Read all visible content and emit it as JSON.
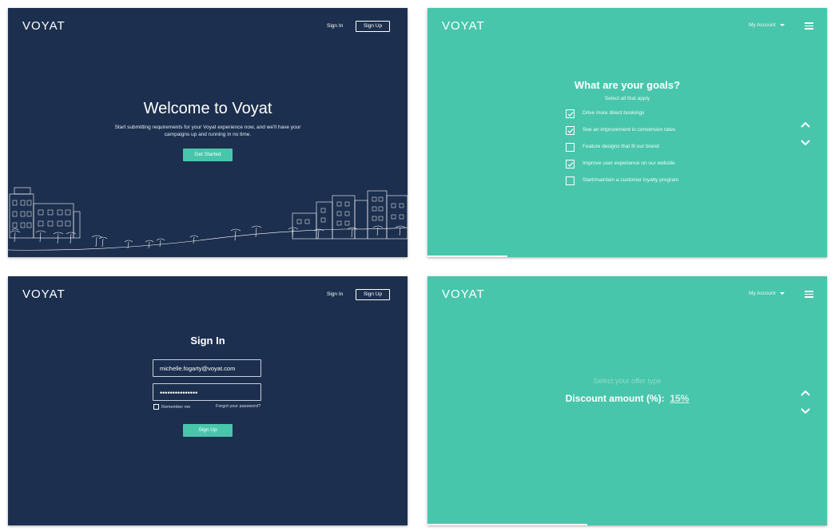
{
  "brand": {
    "logo": "VOYAT",
    "navy": "#1c2f4e",
    "teal": "#48c6ac"
  },
  "welcome_screen": {
    "nav": {
      "sign_in": "Sign In",
      "sign_up": "Sign Up"
    },
    "title": "Welcome to Voyat",
    "subtitle": "Start submitting requirements for your Voyat experience now, and we'll have your campaigns up and running in no time.",
    "cta": "Get Started"
  },
  "goals_screen": {
    "nav": {
      "account": "My Account",
      "menu_icon": "hamburger-icon"
    },
    "title": "What are your goals?",
    "subtitle": "Select all that apply",
    "goals": [
      {
        "label": "Drive more direct bookings",
        "checked": true
      },
      {
        "label": "See an improvement in conversion rates",
        "checked": true
      },
      {
        "label": "Feature designs that fit our brand",
        "checked": false
      },
      {
        "label": "Improve user experience on our website",
        "checked": true
      },
      {
        "label": "Start/maintain a customer loyalty program",
        "checked": false
      }
    ],
    "up_icon": "chevron-up-icon",
    "down_icon": "chevron-down-icon",
    "progress": 0.2
  },
  "signin_screen": {
    "nav": {
      "sign_in": "Sign In",
      "sign_up": "Sign Up"
    },
    "title": "Sign In",
    "email_value": "michelle.fogarty@voyat.com",
    "password_value": "•••••••••••••••",
    "remember_label": "Remember me",
    "forgot_label": "Forgot your password?",
    "submit": "Sign Up"
  },
  "offer_screen": {
    "nav": {
      "account": "My Account",
      "menu_icon": "hamburger-icon"
    },
    "prompt": "Select your offer type",
    "field_label": "Discount amount (%):",
    "field_value": "15%",
    "up_icon": "chevron-up-icon",
    "down_icon": "chevron-down-icon",
    "progress": 0.4
  }
}
